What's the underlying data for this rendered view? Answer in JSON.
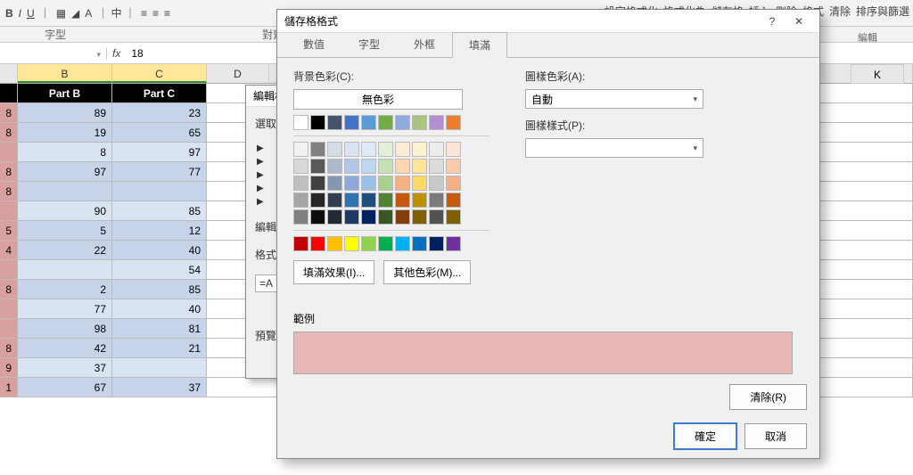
{
  "ribbon": {
    "bold": "B",
    "italic": "I",
    "underline": "U",
    "font_group": "字型",
    "align_group": "對齊",
    "cond_format": "設定格式化",
    "format_as": "格式化為",
    "cell_styles": "儲存格",
    "insert": "插入",
    "delete": "刪除",
    "format": "格式",
    "clear": "清除",
    "sort_filter": "排序與篩選",
    "edit_group": "編輯"
  },
  "formula_bar": {
    "name": "",
    "fx": "fx",
    "value": "18"
  },
  "columns": {
    "B": "B",
    "C": "C",
    "D": "D",
    "K": "K"
  },
  "headers": {
    "B": "Part B",
    "C": "Part C"
  },
  "rows": [
    {
      "a": "8",
      "b": "89",
      "c": "23",
      "alt": true
    },
    {
      "a": "8",
      "b": "19",
      "c": "65",
      "alt": true
    },
    {
      "a": "",
      "b": "8",
      "c": "97",
      "alt": false
    },
    {
      "a": "8",
      "b": "97",
      "c": "77",
      "alt": true
    },
    {
      "a": "8",
      "b": "",
      "c": "",
      "alt": true
    },
    {
      "a": "",
      "b": "90",
      "c": "85",
      "alt": false
    },
    {
      "a": "5",
      "b": "5",
      "c": "12",
      "alt": true
    },
    {
      "a": "4",
      "b": "22",
      "c": "40",
      "alt": true
    },
    {
      "a": "",
      "b": "",
      "c": "54",
      "alt": false
    },
    {
      "a": "8",
      "b": "2",
      "c": "85",
      "alt": true
    },
    {
      "a": "",
      "b": "77",
      "c": "40",
      "alt": false
    },
    {
      "a": "",
      "b": "98",
      "c": "81",
      "alt": true
    },
    {
      "a": "8",
      "b": "42",
      "c": "21",
      "alt": true
    },
    {
      "a": "9",
      "b": "37",
      "c": "",
      "alt": false
    },
    {
      "a": "1",
      "b": "67",
      "c": "37",
      "alt": true
    }
  ],
  "back_dialog": {
    "title": "編輯格式化規則",
    "select_label": "選取規則類型",
    "edit_label": "編輯規則",
    "format_label": "格式",
    "formula_prefix": "=A",
    "preview_label": "預覽"
  },
  "dialog": {
    "title": "儲存格格式",
    "help": "?",
    "close": "✕",
    "tabs": {
      "number": "數值",
      "font": "字型",
      "border": "外框",
      "fill": "填滿"
    },
    "bg_color_label": "背景色彩(C):",
    "no_color": "無色彩",
    "fill_effects": "填滿效果(I)...",
    "more_colors": "其他色彩(M)...",
    "pattern_color_label": "圖樣色彩(A):",
    "pattern_color_value": "自動",
    "pattern_style_label": "圖樣樣式(P):",
    "pattern_style_value": "",
    "example_label": "範例",
    "clear": "清除(R)",
    "ok": "確定",
    "cancel": "取消",
    "example_color": "#e8b8b8"
  },
  "palette": {
    "row1": [
      "#ffffff",
      "#000000",
      "#44546a",
      "#4472c4",
      "#5b9bd5",
      "#70ad47",
      "#8faadc",
      "#a9c47f",
      "#b28fce",
      "#ed7d31"
    ],
    "row2": [
      "#f2f2f2",
      "#7f7f7f",
      "#d6dce5",
      "#d9e1f2",
      "#deebf7",
      "#e2f0d9",
      "#fdebd3",
      "#fff2cc",
      "#ededed",
      "#fce4d6"
    ],
    "row3": [
      "#d9d9d9",
      "#595959",
      "#adb9ca",
      "#b4c6e7",
      "#bdd7ee",
      "#c6e0b4",
      "#fcd5b4",
      "#ffe699",
      "#dbdbdb",
      "#f8cbad"
    ],
    "row4": [
      "#bfbfbf",
      "#404040",
      "#8497b0",
      "#8ea9db",
      "#9bc2e6",
      "#a9d08e",
      "#f4b183",
      "#ffd966",
      "#c9c9c9",
      "#f4b084"
    ],
    "row5": [
      "#a6a6a6",
      "#262626",
      "#333f50",
      "#2f75b5",
      "#1f4e78",
      "#548235",
      "#c65911",
      "#bf8f00",
      "#7b7b7b",
      "#c55a11"
    ],
    "row6": [
      "#808080",
      "#0d0d0d",
      "#222a35",
      "#1f3864",
      "#002060",
      "#385723",
      "#833c0c",
      "#806000",
      "#525252",
      "#7f6000"
    ],
    "std": [
      "#c00000",
      "#ff0000",
      "#ffc000",
      "#ffff00",
      "#92d050",
      "#00b050",
      "#00b0f0",
      "#0070c0",
      "#002060",
      "#7030a0"
    ]
  }
}
